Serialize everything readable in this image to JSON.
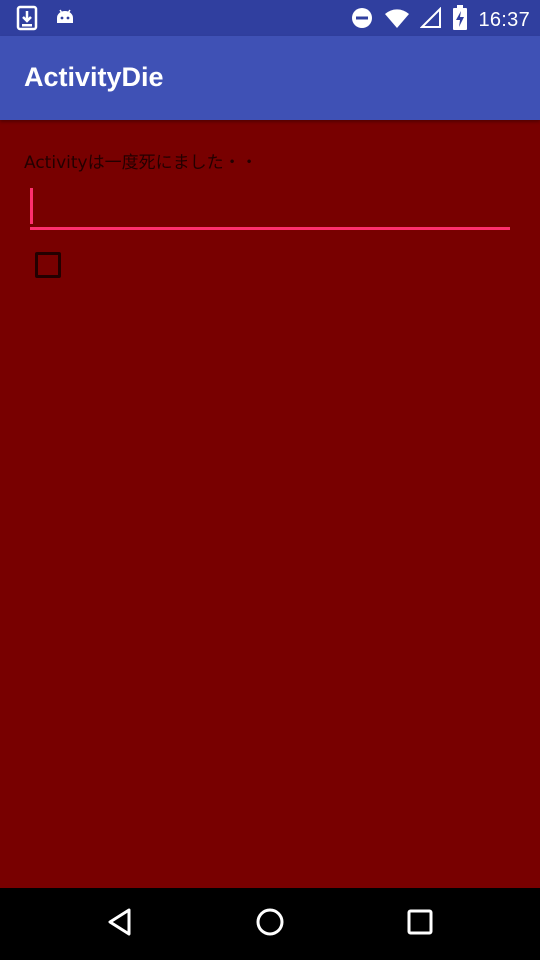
{
  "status_bar": {
    "time": "16:37",
    "left_icons": [
      "download-icon",
      "android-icon"
    ],
    "right_icons": [
      "do-not-disturb-icon",
      "wifi-icon",
      "signal-icon",
      "battery-charging-icon"
    ],
    "color": "#303F9F"
  },
  "app_bar": {
    "title": "ActivityDie",
    "color": "#3F51B5"
  },
  "content": {
    "background": "#780000",
    "message": "Activityは一度死にました・・",
    "input": {
      "value": "",
      "placeholder": "",
      "accent": "#FF2F6E"
    },
    "checkbox": {
      "checked": false
    }
  },
  "nav_bar": {
    "buttons": [
      "back-icon",
      "home-icon",
      "recents-icon"
    ]
  }
}
